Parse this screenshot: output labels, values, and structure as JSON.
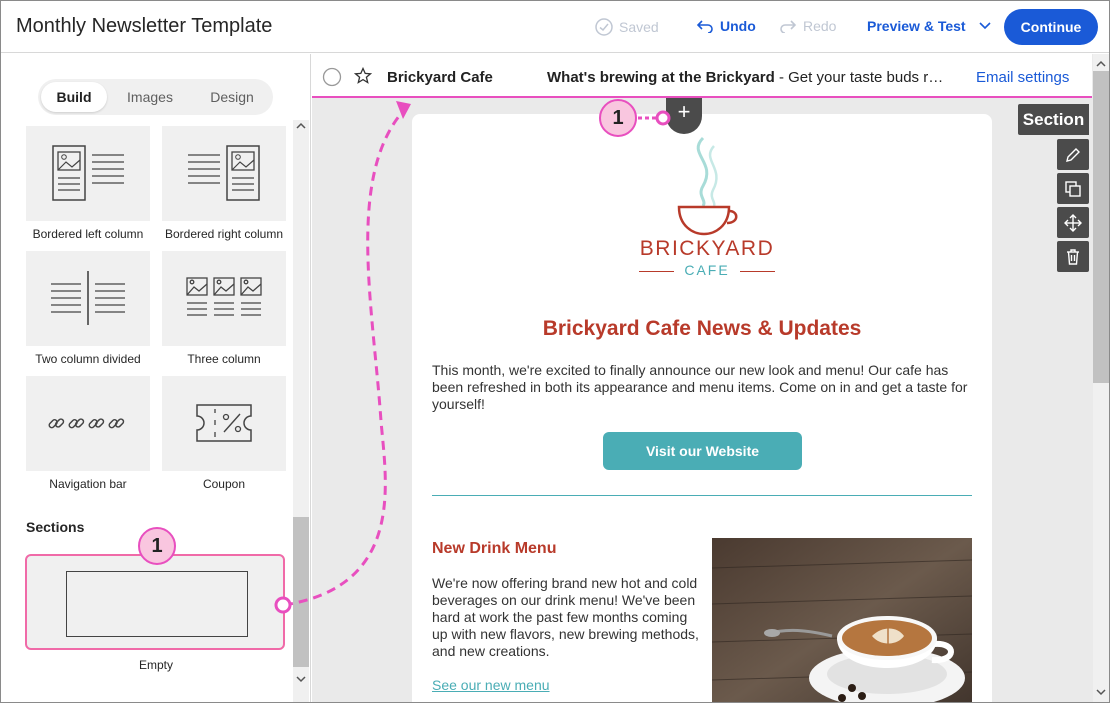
{
  "header": {
    "title": "Monthly Newsletter Template",
    "saved_label": "Saved",
    "undo_label": "Undo",
    "redo_label": "Redo",
    "preview_label": "Preview & Test",
    "continue_label": "Continue"
  },
  "left_panel": {
    "tabs": [
      "Build",
      "Images",
      "Design"
    ],
    "active_tab": "Build",
    "blocks": [
      {
        "label": "Bordered left column",
        "icon": "bordered-left-column-icon"
      },
      {
        "label": "Bordered right column",
        "icon": "bordered-right-column-icon"
      },
      {
        "label": "Two column divided",
        "icon": "two-column-divided-icon"
      },
      {
        "label": "Three column",
        "icon": "three-column-icon"
      },
      {
        "label": "Navigation bar",
        "icon": "link-chain-icon"
      },
      {
        "label": "Coupon",
        "icon": "coupon-percent-icon"
      }
    ],
    "sections_heading": "Sections",
    "sections": [
      {
        "label": "Empty"
      }
    ]
  },
  "subject_bar": {
    "sender": "Brickyard Cafe",
    "subject_bold": "What's brewing at the Brickyard",
    "subject_rest": " - Get your taste buds r…",
    "settings_link": "Email settings"
  },
  "email": {
    "logo_text": "BRICKYARD",
    "logo_subtext": "CAFE",
    "title": "Brickyard Cafe News & Updates",
    "intro": "This month, we're excited to finally announce our new look and menu! Our cafe has been refreshed in both its appearance and menu items. Come on in and get a taste for yourself!",
    "button_label": "Visit our Website",
    "drink_heading": "New Drink Menu",
    "drink_text": "We're now offering brand new hot and cold beverages on our drink menu! We've been hard at work the past few months coming up with new flavors, new brewing methods, and new creations.",
    "drink_link": "See our new menu"
  },
  "section_toolbar": {
    "label": "Section",
    "tools": [
      "pencil-icon",
      "duplicate-icon",
      "move-icon",
      "trash-icon"
    ]
  },
  "annotations": {
    "badge_1": "1",
    "badge_2": "1"
  },
  "colors": {
    "accent": "#1a5ad7",
    "brand_red": "#b83a2a",
    "teal": "#4aadb5",
    "highlight_pink": "#e84fbf"
  }
}
